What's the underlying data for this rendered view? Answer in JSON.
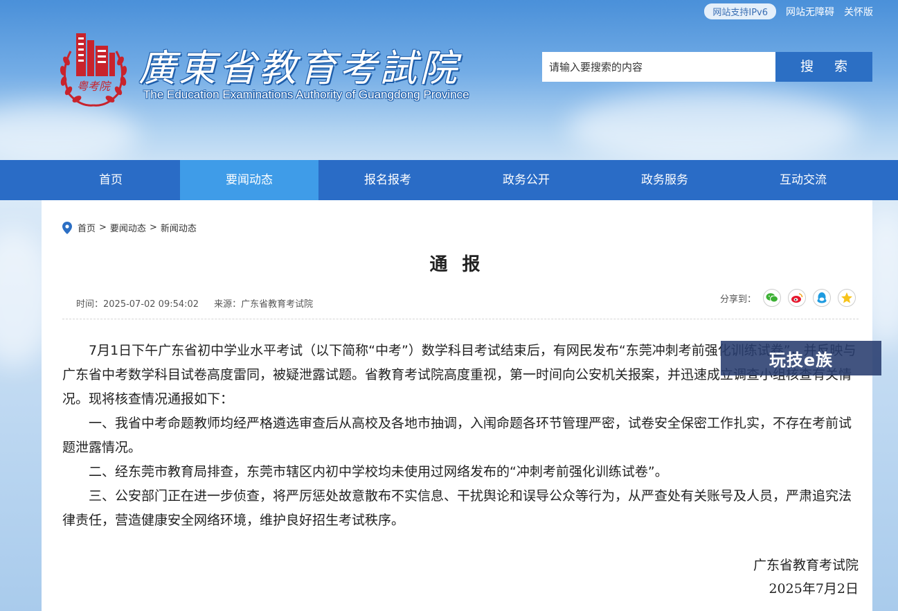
{
  "header": {
    "ipv6_badge": "网站支持IPv6",
    "accessibility_link": "网站无障碍",
    "care_link": "关怀版",
    "site_title": "廣東省教育考試院",
    "site_subtitle": "The Education Examinations Authority of Guangdong Province",
    "logo_text": "粤考院",
    "search": {
      "placeholder": "请输入要搜索的内容",
      "button_label": "搜 索"
    }
  },
  "nav": {
    "items": [
      {
        "label": "首页"
      },
      {
        "label": "要闻动态"
      },
      {
        "label": "报名报考"
      },
      {
        "label": "政务公开"
      },
      {
        "label": "政务服务"
      },
      {
        "label": "互动交流"
      }
    ],
    "active_index": 1
  },
  "breadcrumb": {
    "items": [
      "首页",
      "要闻动态",
      "新闻动态"
    ],
    "separator": ">"
  },
  "article": {
    "title": "通 报",
    "time": "时间：2025-07-02 09:54:02",
    "source": "来源：广东省教育考试院",
    "share_label": "分享到：",
    "share_icons": [
      "wechat-icon",
      "weibo-icon",
      "qq-icon",
      "qzone-icon"
    ],
    "paragraphs": [
      "7月1日下午广东省初中学业水平考试（以下简称“中考”）数学科目考试结束后，有网民发布“东莞冲刺考前强化训练试卷”，并反映与广东省中考数学科目试卷高度雷同，被疑泄露试题。省教育考试院高度重视，第一时间向公安机关报案，并迅速成立调查小组核查有关情况。现将核查情况通报如下：",
      "一、我省中考命题教师均经严格遴选审查后从高校及各地市抽调，入闱命题各环节管理严密，试卷安全保密工作扎实，不存在考前试题泄露情况。",
      "二、经东莞市教育局排查，东莞市辖区内初中学校均未使用过网络发布的“冲刺考前强化训练试卷”。",
      "三、公安部门正在进一步侦查，将严厉惩处故意散布不实信息、干扰舆论和误导公众等行为，从严查处有关账号及人员，严肃追究法律责任，营造健康安全网络环境，维护良好招生考试秩序。"
    ],
    "signature_org": "广东省教育考试院",
    "signature_date": "2025年7月2日"
  },
  "watermark": {
    "text": "玩技e族"
  },
  "colors": {
    "nav_bg": "#2a6cc6",
    "nav_active": "#3f9ce8",
    "search_button": "#2c6fc4",
    "logo_red": "#c8232c"
  }
}
